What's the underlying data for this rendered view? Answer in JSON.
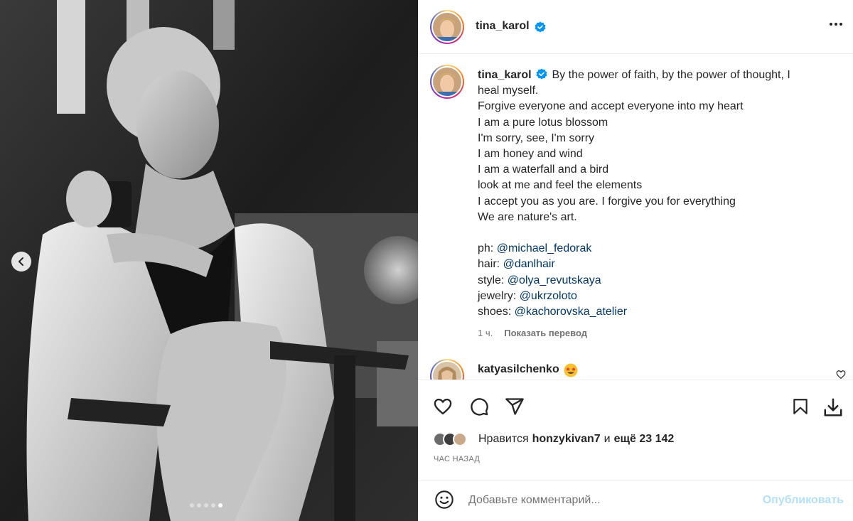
{
  "post": {
    "username": "tina_karol",
    "verified": true
  },
  "carousel": {
    "total_slides": 5,
    "active_slide": 5
  },
  "caption": {
    "username": "tina_karol",
    "lines": [
      "By the power of faith, by the power of thought, I",
      "heal myself.",
      "Forgive everyone and accept everyone into my heart",
      "I am a pure lotus blossom",
      "I'm sorry, see, I'm sorry",
      "I am honey and wind",
      "I am a waterfall and a bird",
      "look at me and feel the elements",
      "I accept you as you are. I forgive you for everything",
      "We are nature's art."
    ],
    "credits": [
      {
        "label": "ph:",
        "mention": "@michael_fedorak"
      },
      {
        "label": "hair:",
        "mention": "@danlhair"
      },
      {
        "label": "style:",
        "mention": "@olya_revutskaya"
      },
      {
        "label": "jewelry:",
        "mention": "@ukrzoloto"
      },
      {
        "label": "shoes:",
        "mention": "@kachorovska_atelier"
      }
    ],
    "age": "1 ч.",
    "translate_label": "Показать перевод"
  },
  "first_comment": {
    "username": "katyasilchenko",
    "emoji": "star-struck-emoji"
  },
  "likes": {
    "prefix": "Нравится",
    "user": "honzykivan7",
    "connector": "и",
    "count_text": "ещё 23 142"
  },
  "timestamp": "ЧАС НАЗАД",
  "comment_box": {
    "placeholder": "Добавьте комментарий...",
    "publish_label": "Опубликовать"
  },
  "icons": {
    "like": "heart-icon",
    "comment": "comment-icon",
    "share": "send-icon",
    "save": "bookmark-icon",
    "download": "download-icon",
    "emoji": "smile-icon",
    "more": "more-icon",
    "prev": "chevron-left-icon"
  },
  "colors": {
    "link": "#00376b",
    "publish_disabled": "#b2dffc",
    "verified": "#0095f6",
    "secondary_text": "#737373"
  }
}
